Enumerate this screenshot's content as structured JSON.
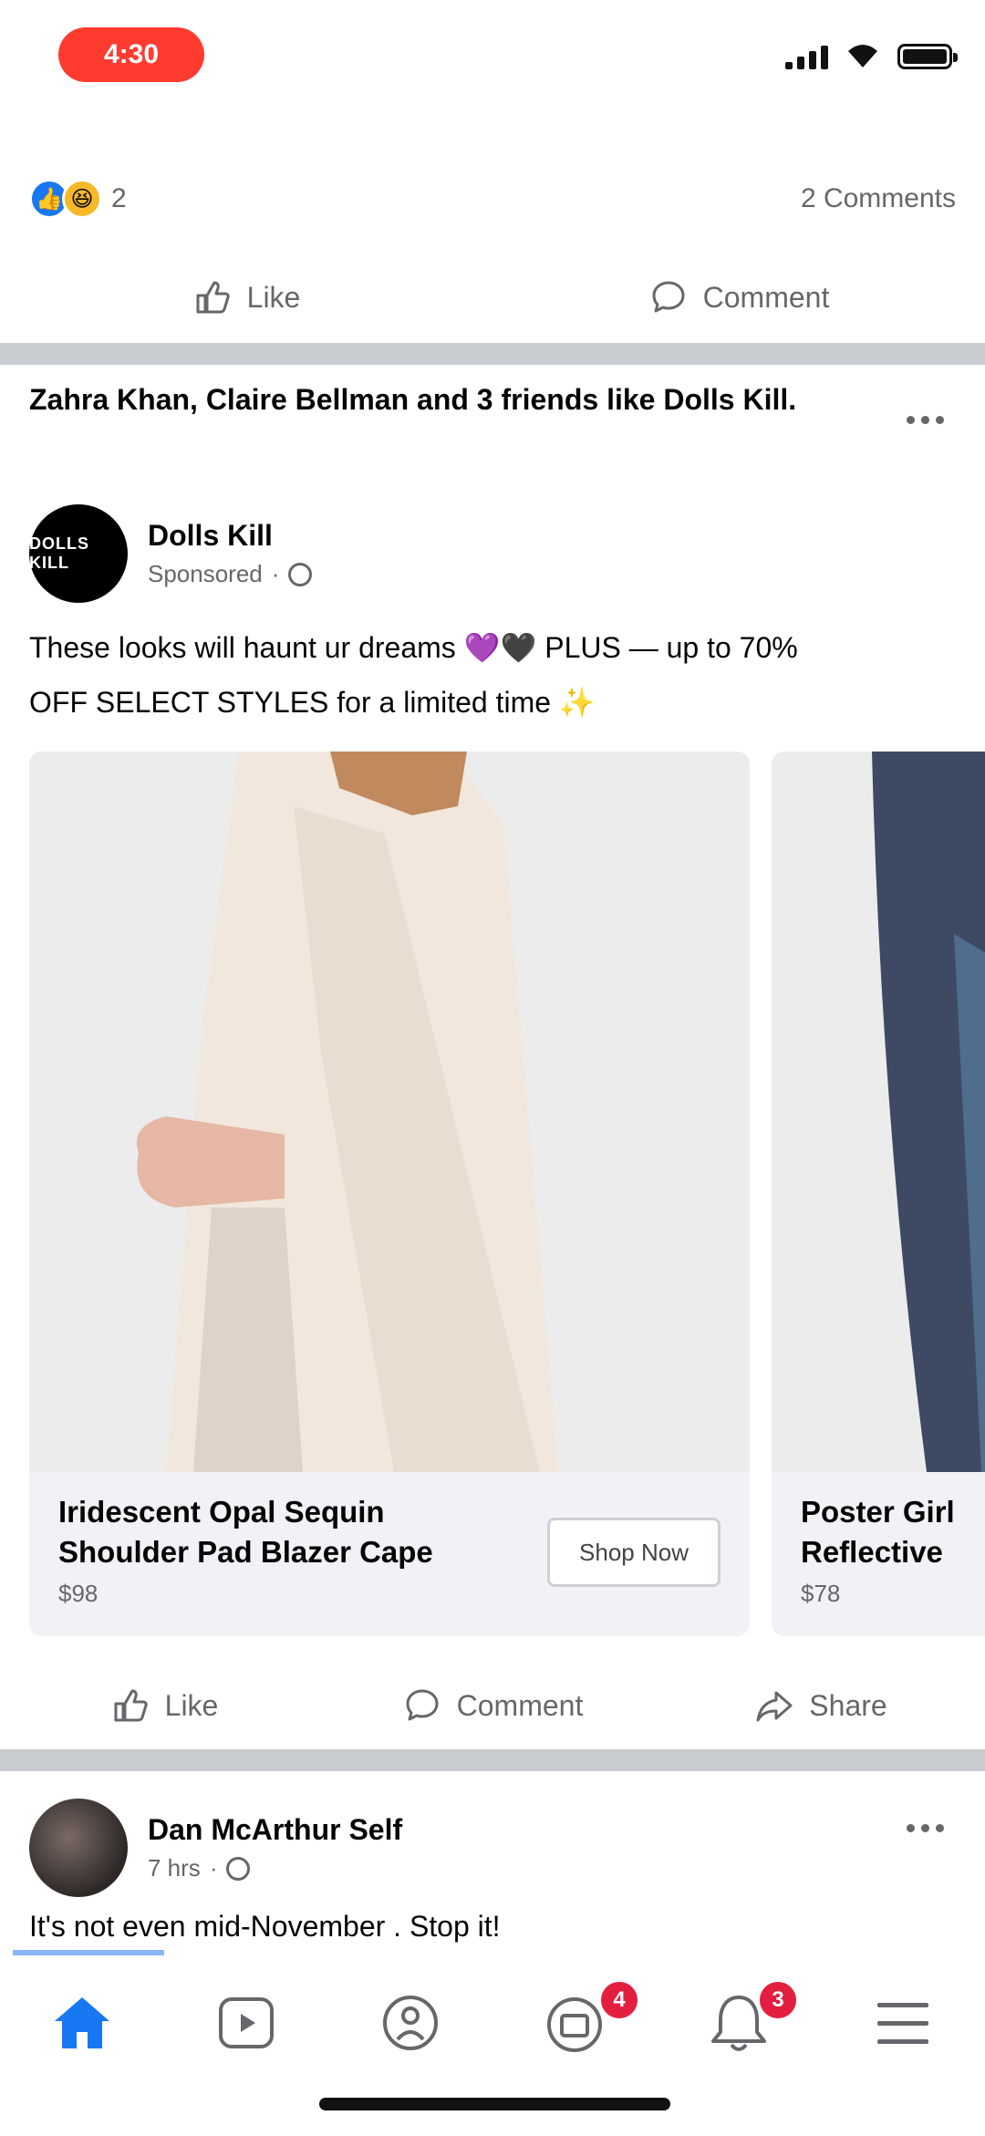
{
  "status_bar": {
    "time": "4:30"
  },
  "prev_post": {
    "reaction_count": "2",
    "comments": "2 Comments",
    "like_label": "Like",
    "comment_label": "Comment"
  },
  "ad_post": {
    "friends_line": "Zahra Khan, Claire Bellman and 3 friends like Dolls Kill.",
    "page_name": "Dolls Kill",
    "sponsored": "Sponsored",
    "text_line1": "These looks will haunt ur dreams 💜🖤 PLUS — up to 70%",
    "text_line2": "OFF SELECT STYLES for a limited time ✨",
    "cards": [
      {
        "caption": "Iridescent Opal Sequin Shoulder Pad Blazer Cape",
        "price": "$98",
        "button": "Shop Now"
      },
      {
        "caption": "Poster Girl Reflective",
        "price": "$78"
      }
    ],
    "like_label": "Like",
    "comment_label": "Comment",
    "share_label": "Share"
  },
  "next_post": {
    "author": "Dan McArthur Self",
    "time": "7 hrs",
    "text": "It's not even mid-November . Stop it!"
  },
  "bottom_nav": {
    "groups_badge": "4",
    "notifications_badge": "3"
  },
  "colors": {
    "accent": "#1877f2",
    "badge": "#e41e3f",
    "status_pill": "#ff3b30"
  },
  "icons": [
    "home-icon",
    "watch-icon",
    "marketplace-icon",
    "groups-icon",
    "bell-icon",
    "menu-icon"
  ]
}
